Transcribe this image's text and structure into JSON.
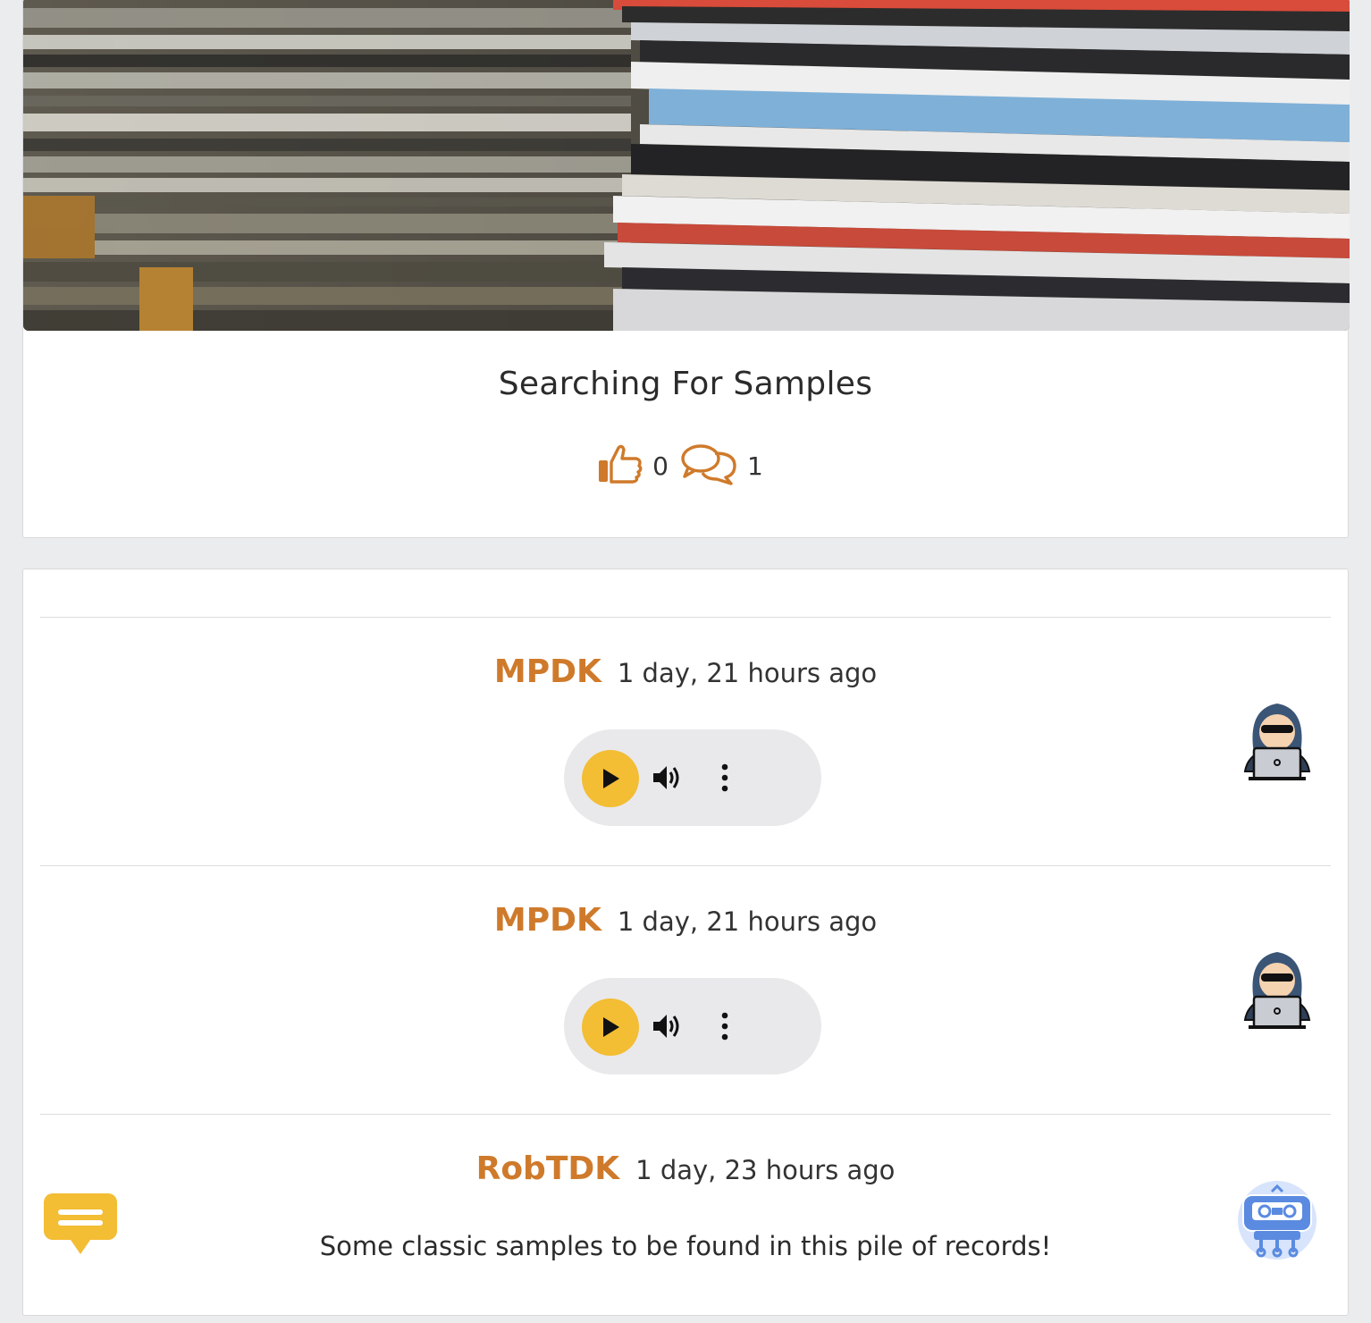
{
  "post": {
    "title": "Searching For Samples",
    "likes": "0",
    "comments_count": "1",
    "hero_image": "stack-of-vinyl-records-photo"
  },
  "colors": {
    "accent": "#cf7a2b",
    "play": "#f3bd34",
    "background": "#ebecee"
  },
  "comments": [
    {
      "user": "MPDK",
      "time": "1 day, 21 hours ago",
      "type": "audio",
      "icon": "audio-wave-icon",
      "avatar": "hacker-avatar"
    },
    {
      "user": "MPDK",
      "time": "1 day, 21 hours ago",
      "type": "audio",
      "icon": "audio-wave-icon",
      "avatar": "hacker-avatar"
    },
    {
      "user": "RobTDK",
      "time": "1 day, 23 hours ago",
      "type": "text",
      "text": "Some classic samples to be found in this pile of records!",
      "icon": "message-bubble-icon",
      "avatar": "cassette-robot-avatar"
    }
  ]
}
